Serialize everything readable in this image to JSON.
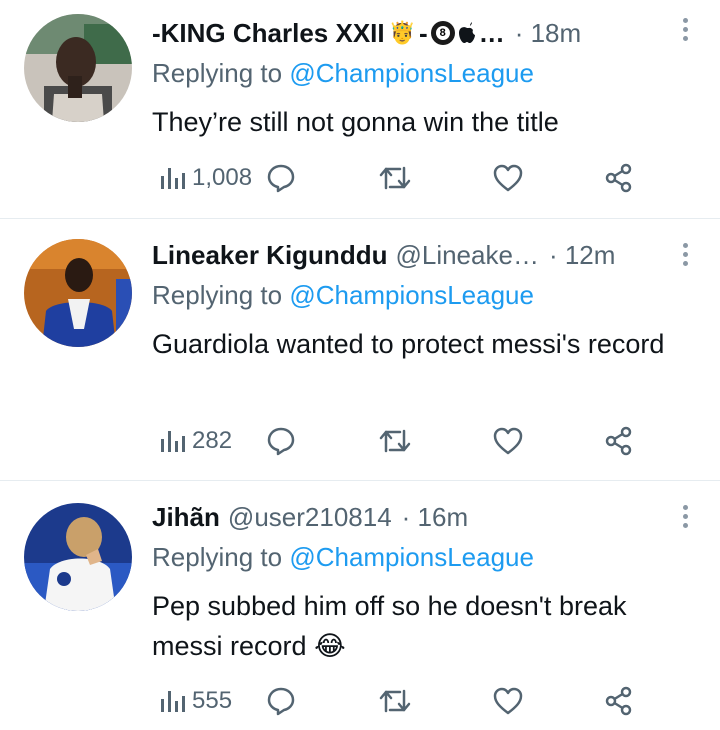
{
  "tweets": [
    {
      "name": "-KING Charles XXII",
      "name_suffix": "-",
      "handle": "",
      "ellipsis": "…",
      "time": "· 18m",
      "replying_prefix": "Replying to",
      "replying_to": "@ChampionsLeague",
      "text": "They’re still not gonna win the title",
      "views": "1,008",
      "badges": [
        "prince-emoji",
        "8-ball-emoji",
        "apple-logo"
      ]
    },
    {
      "name": "Lineaker Kigunddu",
      "handle": "@Lineake…",
      "time": "· 12m",
      "replying_prefix": "Replying to",
      "replying_to": "@ChampionsLeague",
      "text": "Guardiola wanted to protect messi's record",
      "views": "282"
    },
    {
      "name": "Jihãn",
      "handle": "@user210814",
      "time": "· 16m",
      "replying_prefix": "Replying to",
      "replying_to": "@ChampionsLeague",
      "text": "Pep subbed him off so he doesn't break messi record",
      "text_emoji": "😂",
      "views": "555"
    }
  ],
  "colors": {
    "link": "#1d9bf0",
    "secondary": "#536471",
    "divider": "#e6ecf0"
  }
}
